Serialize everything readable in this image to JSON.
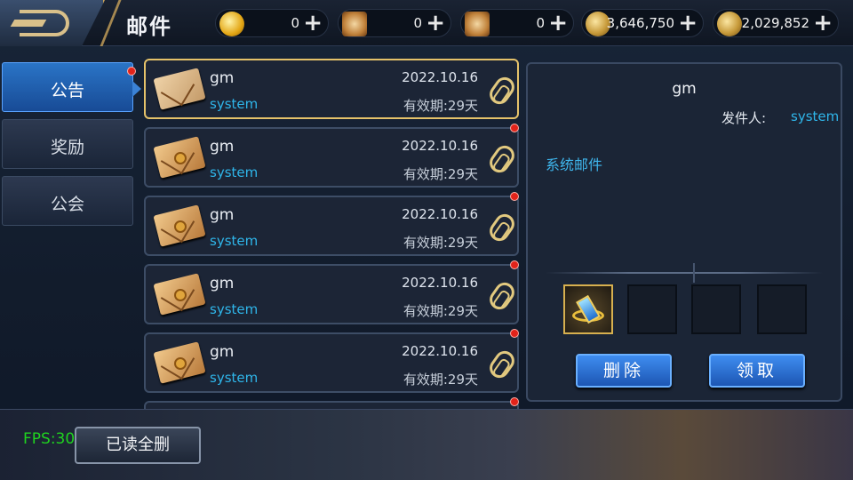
{
  "header": {
    "title": "邮件",
    "resources": [
      {
        "name": "gold-gem-icon",
        "value": "0"
      },
      {
        "name": "red-scroll-icon",
        "value": "0"
      },
      {
        "name": "locked-scroll-icon",
        "value": "0"
      },
      {
        "name": "coin-icon",
        "value": "3,646,750"
      },
      {
        "name": "locked-coin-icon",
        "value": "2,029,852"
      }
    ],
    "plus_symbol": "+"
  },
  "nav": {
    "tabs": [
      {
        "label": "公告",
        "active": true,
        "unread": true
      },
      {
        "label": "奖励",
        "active": false,
        "unread": false
      },
      {
        "label": "公会",
        "active": false,
        "unread": false
      }
    ]
  },
  "mails": [
    {
      "sender": "gm",
      "from": "system",
      "date": "2022.10.16",
      "expiry": "有效期:29天",
      "opened": true,
      "unread_dot": false
    },
    {
      "sender": "gm",
      "from": "system",
      "date": "2022.10.16",
      "expiry": "有效期:29天",
      "opened": false,
      "unread_dot": true
    },
    {
      "sender": "gm",
      "from": "system",
      "date": "2022.10.16",
      "expiry": "有效期:29天",
      "opened": false,
      "unread_dot": true
    },
    {
      "sender": "gm",
      "from": "system",
      "date": "2022.10.16",
      "expiry": "有效期:29天",
      "opened": false,
      "unread_dot": true
    },
    {
      "sender": "gm",
      "from": "system",
      "date": "2022.10.16",
      "expiry": "有效期:29天",
      "opened": false,
      "unread_dot": true
    }
  ],
  "detail": {
    "sender": "gm",
    "from_label": "发件人:",
    "from_value": "system",
    "body": "系统邮件",
    "attachments": [
      "blue-crystal-item-icon",
      "",
      "",
      ""
    ],
    "delete_label": "删除",
    "claim_label": "领取"
  },
  "footer": {
    "fps": "FPS:30",
    "read_all_delete": "已读全删"
  },
  "colors": {
    "accent_blue": "#2fb6ea",
    "selected_border": "#e5c26a",
    "unread_dot": "#e2231a",
    "fps_green": "#1fd31f"
  }
}
